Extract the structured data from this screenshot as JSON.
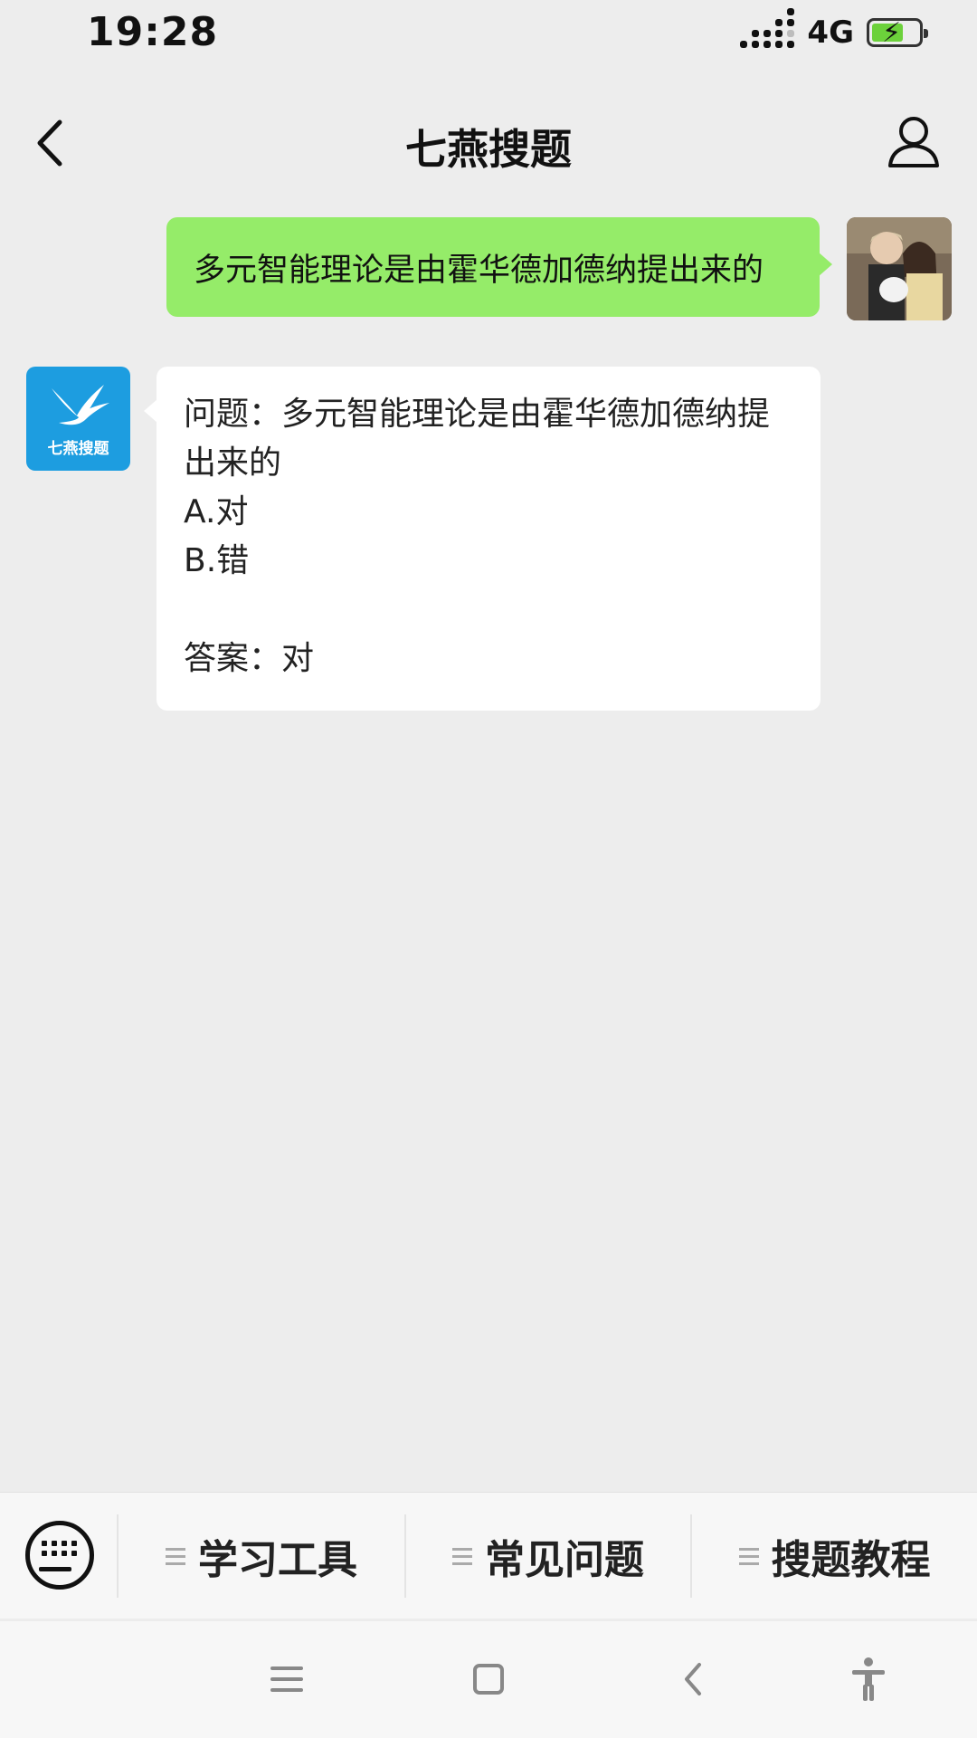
{
  "status_bar": {
    "time": "19:28",
    "network": "4G"
  },
  "nav": {
    "title": "七燕搜题"
  },
  "messages": {
    "sent": {
      "text": "多元智能理论是由霍华德加德纳提出来的"
    },
    "received": {
      "lines": [
        "问题：多元智能理论是由霍华德加德纳提",
        "出来的",
        "A.对",
        "B.错"
      ],
      "answer": "答案：对"
    }
  },
  "bot_avatar": {
    "label": "七燕搜题"
  },
  "menu": {
    "items": [
      {
        "label": "学习工具"
      },
      {
        "label": "常见问题"
      },
      {
        "label": "搜题教程"
      }
    ]
  },
  "colors": {
    "sent_bubble": "#95ec69",
    "bot_avatar_bg": "#1d9de0",
    "background": "#ededed"
  }
}
